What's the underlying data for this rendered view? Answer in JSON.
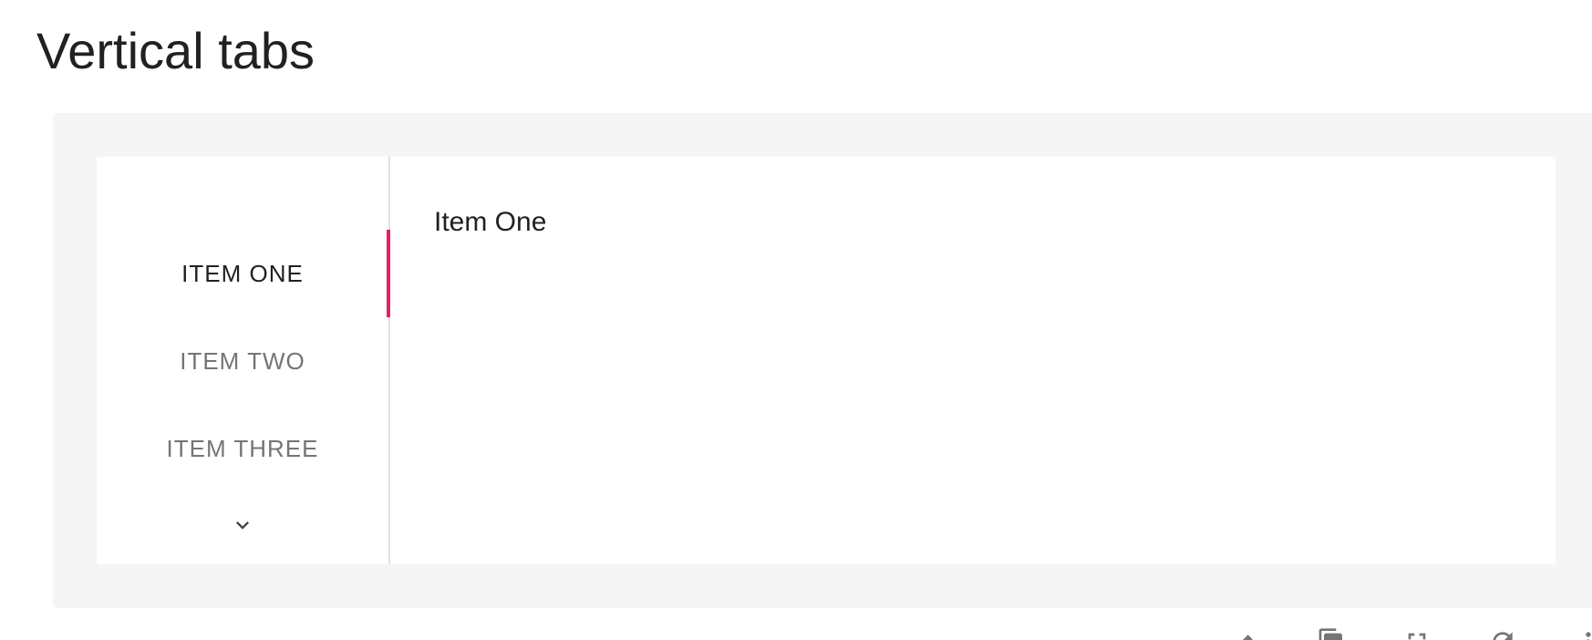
{
  "page": {
    "title": "Vertical tabs"
  },
  "tabs": {
    "items": [
      {
        "label": "ITEM ONE",
        "active": true
      },
      {
        "label": "ITEM TWO",
        "active": false
      },
      {
        "label": "ITEM THREE",
        "active": false
      }
    ],
    "scroll_icon": "chevron-down-icon",
    "content": "Item One"
  },
  "colors": {
    "indicator": "#e91e63",
    "card_background": "#f5f5f5",
    "active_text": "#212121",
    "inactive_text": "#757575"
  },
  "toolbar": {
    "icons": [
      "edit-icon",
      "copy-icon",
      "fullscreen-icon",
      "refresh-icon",
      "more-icon"
    ]
  }
}
